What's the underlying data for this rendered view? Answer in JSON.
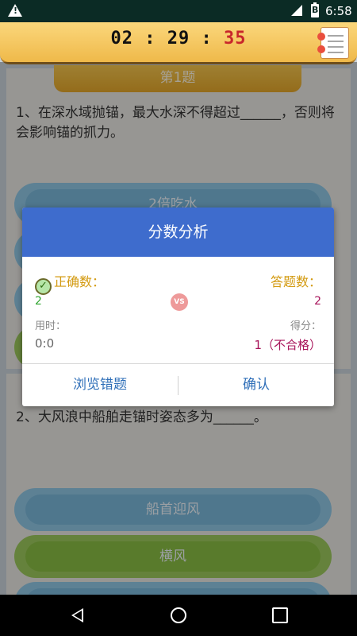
{
  "status_bar": {
    "time": "6:58",
    "battery_label": "B"
  },
  "timer": {
    "hm": "02 : 29 : ",
    "seconds": "35"
  },
  "question1": {
    "header": "第1题",
    "text": "1、在深水域抛锚，最大水深不得超过______，否则将会影响锚的抓力。",
    "options": [
      "2倍吃水"
    ]
  },
  "question2": {
    "text": "2、大风浪中船舶走锚时姿态多为______。",
    "options": [
      "船首迎风",
      "横风"
    ]
  },
  "dialog": {
    "title": "分数分析",
    "correct_label": "正确数：",
    "answered_label": "答题数：",
    "correct_value": "2",
    "answered_value": "2",
    "vs_label": "VS",
    "time_label": "用时：",
    "time_value": "0:0",
    "score_label": "得分：",
    "score_value": "1（不合格）",
    "review_button": "浏览错题",
    "confirm_button": "确认"
  },
  "colors": {
    "dialog_header": "#3e6ccd",
    "correct": "#2fa52f",
    "answered": "#a8155b",
    "button_text": "#2f6fb8",
    "label_gold": "#d39a10"
  }
}
